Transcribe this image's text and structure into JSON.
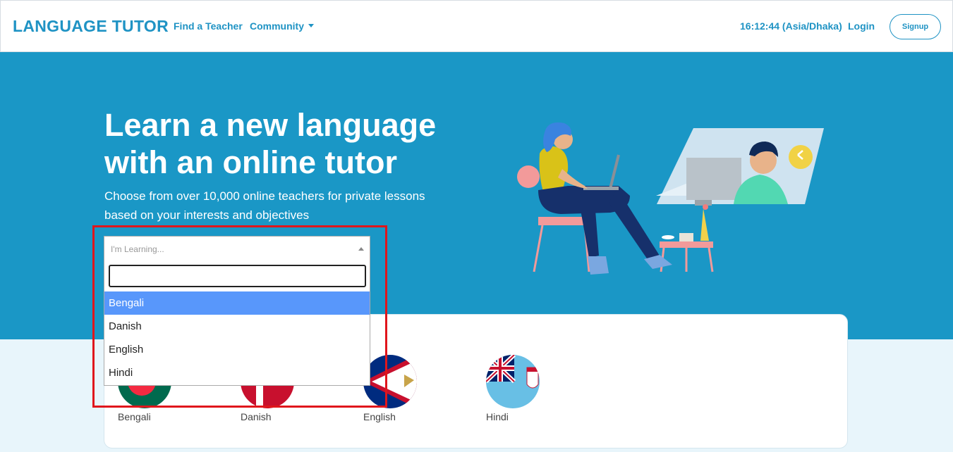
{
  "nav": {
    "brand": "LANGUAGE TUTOR",
    "find_teacher": "Find a Teacher",
    "community": "Community",
    "clock": "16:12:44 (Asia/Dhaka)",
    "login": "Login",
    "signup": "Signup"
  },
  "hero": {
    "title": "Learn a new language with an online tutor",
    "subtitle": "Choose from over 10,000 online teachers for private lessons based on your interests and objectives"
  },
  "language_select": {
    "placeholder": "I'm Learning...",
    "search_value": "",
    "options": [
      "Bengali",
      "Danish",
      "English",
      "Hindi"
    ],
    "highlighted": "Bengali"
  },
  "languages": [
    {
      "name": "Bengali",
      "flag": "bangladesh-flag"
    },
    {
      "name": "Danish",
      "flag": "denmark-flag"
    },
    {
      "name": "English",
      "flag": "american-samoa-flag"
    },
    {
      "name": "Hindi",
      "flag": "fiji-flag"
    }
  ],
  "colors": {
    "brand": "#1f93c4",
    "hero_bg": "#1a97c6",
    "option_highlight": "#5897fb",
    "annotation_border": "#e0161c"
  }
}
